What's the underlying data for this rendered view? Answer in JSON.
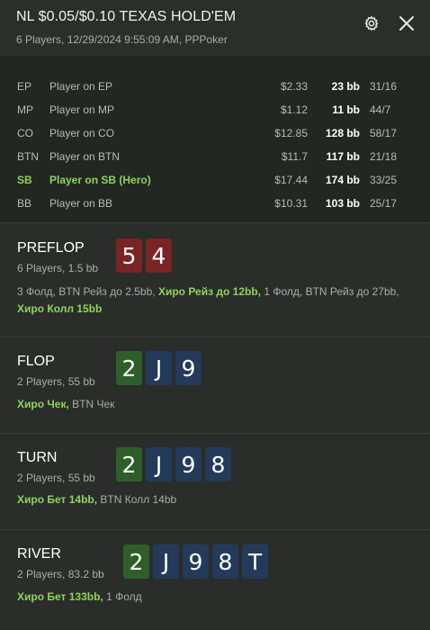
{
  "header": {
    "title": "NL $0.05/$0.10 TEXAS HOLD'EM",
    "subtitle": "6 Players, 12/29/2024 9:55:09 AM, PPPoker",
    "settings_icon": "gear-icon",
    "close_icon": "close-icon"
  },
  "players": [
    {
      "pos": "EP",
      "name": "Player on EP",
      "stack": "$2.33",
      "bb": "23 bb",
      "stat": "31/16",
      "hero": false
    },
    {
      "pos": "MP",
      "name": "Player on MP",
      "stack": "$1.12",
      "bb": "11 bb",
      "stat": "44/7",
      "hero": false
    },
    {
      "pos": "CO",
      "name": "Player on CO",
      "stack": "$12.85",
      "bb": "128 bb",
      "stat": "58/17",
      "hero": false
    },
    {
      "pos": "BTN",
      "name": "Player on BTN",
      "stack": "$11.7",
      "bb": "117 bb",
      "stat": "21/18",
      "hero": false
    },
    {
      "pos": "SB",
      "name": "Player on SB (Hero)",
      "stack": "$17.44",
      "bb": "174 bb",
      "stat": "33/25",
      "hero": true
    },
    {
      "pos": "BB",
      "name": "Player on BB",
      "stack": "$10.31",
      "bb": "103 bb",
      "stat": "25/17",
      "hero": false
    }
  ],
  "streets": {
    "preflop": {
      "name": "PREFLOP",
      "info": "6 Players, 1.5 bb",
      "cards": [
        "5",
        "4"
      ],
      "actions": {
        "a1": "3 Фолд, BTN Рейз до 2.5bb, ",
        "a2": "Хиро Рейз до 12bb,",
        "a3": " 1 Фолд, BTN Рейз до 27bb, ",
        "a4": "Хиро Колл 15bb"
      }
    },
    "flop": {
      "name": "FLOP",
      "info": "2 Players, 55 bb",
      "cards": [
        "2",
        "J",
        "9"
      ],
      "actions": {
        "a1": "Хиро Чек,",
        "a2": " BTN Чек"
      }
    },
    "turn": {
      "name": "TURN",
      "info": "2 Players, 55 bb",
      "cards": [
        "2",
        "J",
        "9",
        "8"
      ],
      "actions": {
        "a1": "Хиро Бет 14bb,",
        "a2": " BTN Колл 14bb"
      }
    },
    "river": {
      "name": "RIVER",
      "info": "2 Players, 83.2 bb",
      "cards": [
        "2",
        "J",
        "9",
        "8",
        "T"
      ],
      "actions": {
        "a1": "Хиро Бет 133bb,",
        "a2": " 1 Фолд"
      }
    }
  },
  "colors": {
    "hero": "#8fd35a",
    "card_red": "#7a2426",
    "card_green": "#2f5e2b",
    "card_blue": "#243a5a"
  }
}
